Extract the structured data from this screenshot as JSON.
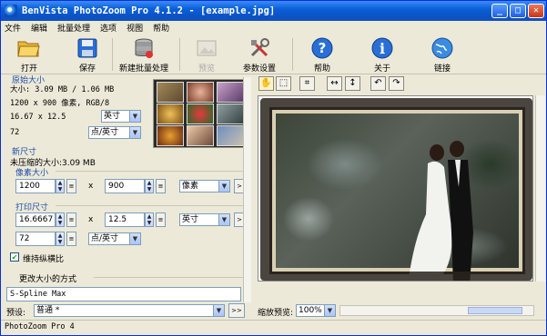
{
  "window": {
    "title": "BenVista PhotoZoom Pro 4.1.2 - [example.jpg]",
    "min": "_",
    "max": "□",
    "close": "✕"
  },
  "menu": [
    "文件",
    "编辑",
    "批量处理",
    "选项",
    "视图",
    "帮助"
  ],
  "toolbar": {
    "open": "打开",
    "save": "保存",
    "batch": "新建批量处理",
    "preview": "预览",
    "settings": "参数设置",
    "help": "帮助",
    "about": "关于",
    "link": "链接"
  },
  "original": {
    "title": "原始大小",
    "size": "大小: 3.09 MB / 1.06 MB",
    "dims": "1200 x 900 像素, RGB/8",
    "inches": "16.67 x 12.5",
    "inch_unit": "英寸",
    "dpi": "72",
    "dpi_unit": "点/英寸"
  },
  "newsize": {
    "title": "新尺寸",
    "uncompressed": "未压缩的大小:3.09 MB",
    "pixel_title": "像素大小",
    "width_px": "1200",
    "height_px": "900",
    "px_unit": "像素",
    "x": "x",
    "print_title": "打印尺寸",
    "width_in": "16.6667",
    "height_in": "12.5",
    "in_unit": "英寸",
    "dpi": "72",
    "dpi_unit": "点/英寸",
    "keep_ratio": "维持纵横比",
    "more": ">"
  },
  "method": {
    "title": "更改大小的方式",
    "value": "S-Spline Max",
    "preset_label": "预设:",
    "preset_value": "普通 *",
    "more": ">>"
  },
  "zoom": {
    "label": "缩放预览:",
    "value": "100%"
  },
  "status": {
    "text": "PhotoZoom Pro 4"
  }
}
